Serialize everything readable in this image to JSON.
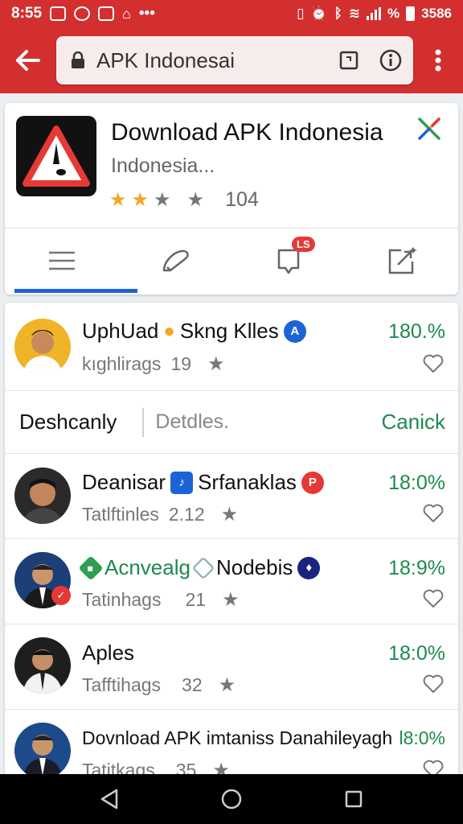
{
  "status_bar": {
    "time": "8:55",
    "battery_text": "%",
    "right_text": "3586"
  },
  "toolbar": {
    "url_text": "APK Indonesai",
    "theme_color": "#d32f2f"
  },
  "app": {
    "title": "Download APK Indonesia",
    "subtitle": "Indonesia...",
    "rating_stars_filled": 2,
    "rating_stars_total": 4,
    "rating_count": "104",
    "tabs": [
      {
        "icon": "list-icon"
      },
      {
        "icon": "pencil-icon"
      },
      {
        "icon": "notification-icon",
        "badge": "LS"
      },
      {
        "icon": "share-icon"
      }
    ]
  },
  "list": {
    "filter": {
      "left": "Deshcanly",
      "middle": "Detdles.",
      "right": "Canick"
    },
    "items": [
      {
        "title_a": "UphUad",
        "title_b": "Skng Klles",
        "meta_label": "kıghlirags",
        "meta_value": "19",
        "percent": "180.%",
        "badge_color": "#1e63d6"
      },
      {
        "title_a": "Deanisar",
        "title_b": "Srfanaklas",
        "meta_label": "Tatlftinles",
        "meta_value": "2.12",
        "percent": "18:0%",
        "badge_color": "#e53935"
      },
      {
        "title_a": "Acnvealg",
        "title_b": "Nodebis",
        "meta_label": "Tatinhags",
        "meta_value": "21",
        "percent": "18:9%",
        "badge_color": "#1a237e"
      },
      {
        "title_a": "Aples",
        "meta_label": "Tafftihags",
        "meta_value": "32",
        "percent": "18:0%"
      },
      {
        "title_a": "Dovnload APK imtaniss Danahileyagh",
        "meta_label": "Tatitkags",
        "meta_value": "35",
        "percent": "l8:0%"
      }
    ]
  },
  "colors": {
    "accent_green": "#1d8a4e",
    "accent_blue": "#1e63d6",
    "brand_red": "#d32f2f"
  }
}
